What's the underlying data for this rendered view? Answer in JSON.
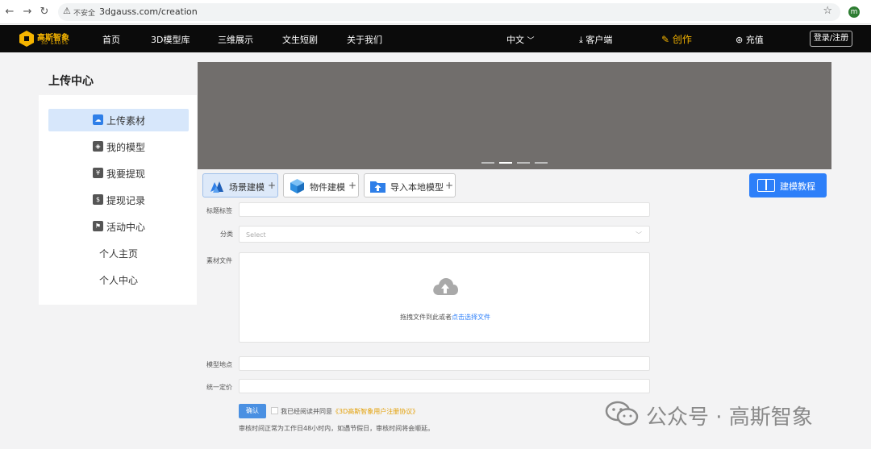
{
  "browser": {
    "insecure_label": "不安全",
    "url": "3dgauss.com/creation",
    "profile_initial": "m"
  },
  "site_nav": {
    "logo_name": "高斯智象",
    "logo_sub": "3D GAUSS",
    "items": [
      "首页",
      "3D模型库",
      "三维展示",
      "文生短剧",
      "关于我们"
    ],
    "language": "中文",
    "client": "客户端",
    "create": "创作",
    "recharge": "充值",
    "login": "登录/注册",
    "accent_color": "#f5b400"
  },
  "sidebar": {
    "title": "上传中心",
    "items": [
      {
        "label": "上传素材",
        "icon": "cloud-upload-icon",
        "active": true
      },
      {
        "label": "我的模型",
        "icon": "cube-icon"
      },
      {
        "label": "我要提现",
        "icon": "wallet-icon"
      },
      {
        "label": "提现记录",
        "icon": "receipt-icon"
      },
      {
        "label": "活动中心",
        "icon": "flag-icon"
      },
      {
        "label": "个人主页"
      },
      {
        "label": "个人中心"
      }
    ]
  },
  "banner": {
    "slide_count": 4,
    "active_slide": 2
  },
  "modes": [
    {
      "label": "场景建模",
      "icon": "scene-model-icon",
      "active": true
    },
    {
      "label": "物件建模",
      "icon": "object-model-icon"
    },
    {
      "label": "导入本地模型",
      "icon": "folder-import-icon"
    }
  ],
  "tutorial_button": "建模教程",
  "form": {
    "title_label": "标题标签",
    "category_label": "分类",
    "category_placeholder": "Select",
    "file_label": "素材文件",
    "drop_text": "拖拽文件到此或者",
    "drop_link": "点击选择文件",
    "location_label": "模型地点",
    "price_label": "统一定价",
    "confirm_button": "确认",
    "agree_text": "我已经阅读并同意",
    "agree_link": "《3D高斯智象用户注册协议》",
    "notice": "审核时间正常为工作日48小时内，如遇节假日，审核时间将会顺延。"
  },
  "watermark": "公众号 · 高斯智象",
  "colors": {
    "primary": "#2d7ff9",
    "active_bg": "#d7e7fb",
    "nav_bg": "#0b0b0b",
    "banner_bg": "#716e6c"
  }
}
